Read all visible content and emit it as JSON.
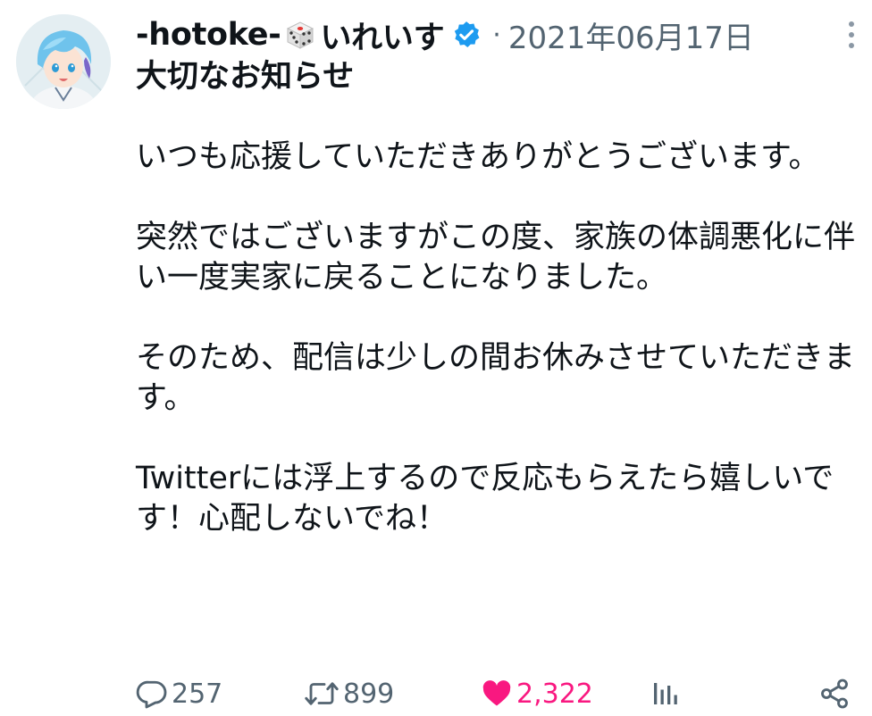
{
  "tweet": {
    "display_name_prefix": "-hotoke-",
    "display_name_suffix": "いれいす",
    "separator": "·",
    "timestamp": "2021年06月17日",
    "title": "大切なお知らせ",
    "paragraphs": [
      "いつも応援していただきありがとうございます。",
      "突然ではございますがこの度、家族の体調悪化に伴い一度実家に戻ることになりました。",
      "そのため、配信は少しの間お休みさせていただきます。",
      "Twitterには浮上するので反応もらえたら嬉しいです！心配しないでね！"
    ],
    "icons": {
      "avatar": "avatar-image",
      "dice": "dice-emoji-icon",
      "verified": "verified-badge-icon",
      "more": "more-options-icon"
    }
  },
  "actions": {
    "reply_count": "257",
    "retweet_count": "899",
    "like_count": "2,322",
    "icons": [
      "reply-icon",
      "retweet-icon",
      "like-icon",
      "views-icon",
      "share-icon"
    ]
  },
  "colors": {
    "text_primary": "#0f1419",
    "text_secondary": "#536471",
    "verified_blue": "#1d9bf0",
    "like_pink": "#f91880"
  }
}
